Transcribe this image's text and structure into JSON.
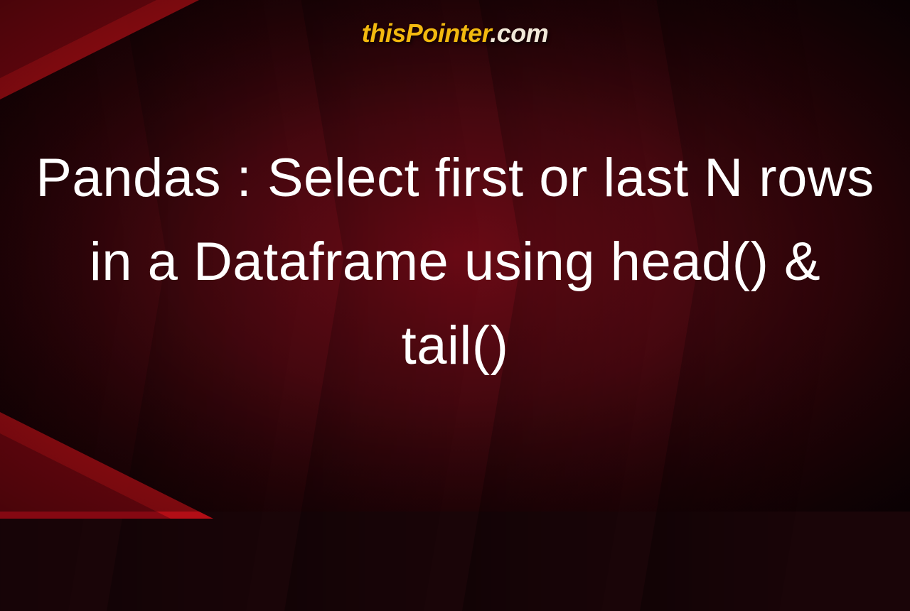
{
  "brand": {
    "part1": "thisPointer",
    "part2": ".com"
  },
  "title": "Pandas : Select first or last N rows in a Dataframe using head() & tail()",
  "colors": {
    "brand_primary": "#f2b90f",
    "brand_secondary": "#f0e8d8",
    "title_color": "#ffffff",
    "bg_dark": "#120205",
    "bg_red": "#6b0a15",
    "accent_red": "#c41018"
  }
}
